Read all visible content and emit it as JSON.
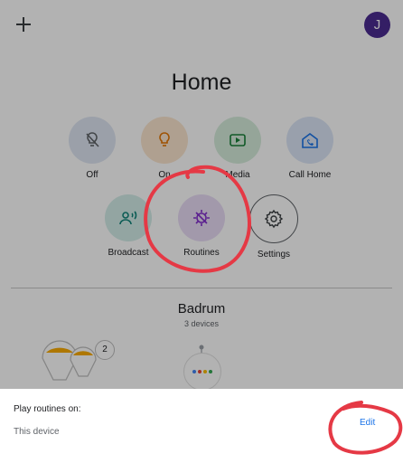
{
  "header": {
    "add_icon": "plus-icon",
    "avatar_letter": "J"
  },
  "home": {
    "title": "Home"
  },
  "actions": [
    {
      "label": "Off",
      "icon": "lightbulb-off-icon"
    },
    {
      "label": "On",
      "icon": "lightbulb-icon"
    },
    {
      "label": "Media",
      "icon": "play-icon"
    },
    {
      "label": "Call Home",
      "icon": "call-home-icon"
    },
    {
      "label": "Broadcast",
      "icon": "broadcast-icon"
    },
    {
      "label": "Routines",
      "icon": "routine-icon"
    },
    {
      "label": "Settings",
      "icon": "gear-icon"
    }
  ],
  "room": {
    "name": "Badrum",
    "devices": "3 devices",
    "light_group_count": "2"
  },
  "sheet": {
    "title": "Play routines on:",
    "device": "This device",
    "edit_label": "Edit"
  },
  "colors": {
    "accent": "#1a73e8",
    "avatar": "#4b2c91",
    "annotation": "#e53945"
  }
}
